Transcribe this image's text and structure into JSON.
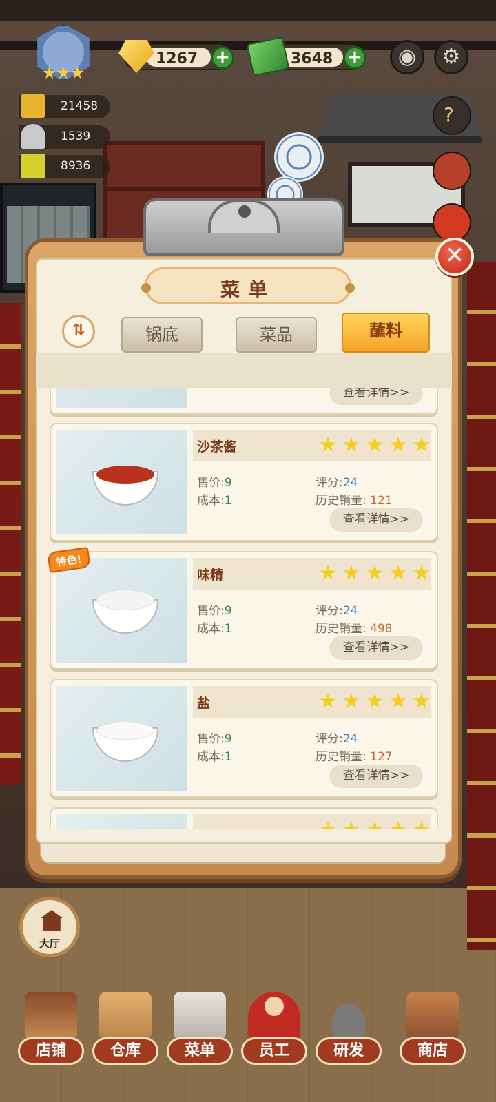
{
  "hud": {
    "gems": "1267",
    "cash": "3648",
    "stat1": "21458",
    "stat2": "1539",
    "stat3": "8936",
    "plus_label": "+"
  },
  "icons": {
    "camera": "camera-icon",
    "settings": "gear-icon",
    "guide": "book-question-icon",
    "close": "close-icon",
    "sort": "sort-icon"
  },
  "panel": {
    "title": "菜单",
    "tabs": [
      {
        "label": "锅底",
        "active": false
      },
      {
        "label": "菜品",
        "active": false
      },
      {
        "label": "蘸料",
        "active": true
      }
    ],
    "sort_label": "⇅",
    "close_label": "✕"
  },
  "items": [
    {
      "name": "沙茶酱",
      "stars": 5,
      "price_label": "售价",
      "price": "9",
      "cost_label": "成本",
      "cost": "1",
      "score_label": "评分",
      "score": "24",
      "sales_label": "历史销量",
      "sales": "121",
      "detail": "查看详情>>",
      "special": false,
      "fill": "#b8321e"
    },
    {
      "name": "味精",
      "stars": 5,
      "price_label": "售价",
      "price": "9",
      "cost_label": "成本",
      "cost": "1",
      "score_label": "评分",
      "score": "24",
      "sales_label": "历史销量",
      "sales": "498",
      "detail": "查看详情>>",
      "special": true,
      "special_label": "特色!",
      "fill": "#f4f4f4"
    },
    {
      "name": "盐",
      "stars": 5,
      "price_label": "售价",
      "price": "9",
      "cost_label": "成本",
      "cost": "1",
      "score_label": "评分",
      "score": "24",
      "sales_label": "历史销量",
      "sales": "127",
      "detail": "查看详情>>",
      "special": false,
      "fill": "#fafafa"
    }
  ],
  "partial_top": {
    "detail": "查看详情>>"
  },
  "hall": {
    "label": "大厅"
  },
  "nav": [
    {
      "label": "店铺"
    },
    {
      "label": "仓库"
    },
    {
      "label": "菜单"
    },
    {
      "label": "员工"
    },
    {
      "label": "研发"
    },
    {
      "label": "商店"
    }
  ],
  "colors": {
    "accent_tab": "#f4a42a",
    "close": "#d33a24",
    "title_text": "#7a3a1c",
    "nav_label": "#a13a1e"
  }
}
